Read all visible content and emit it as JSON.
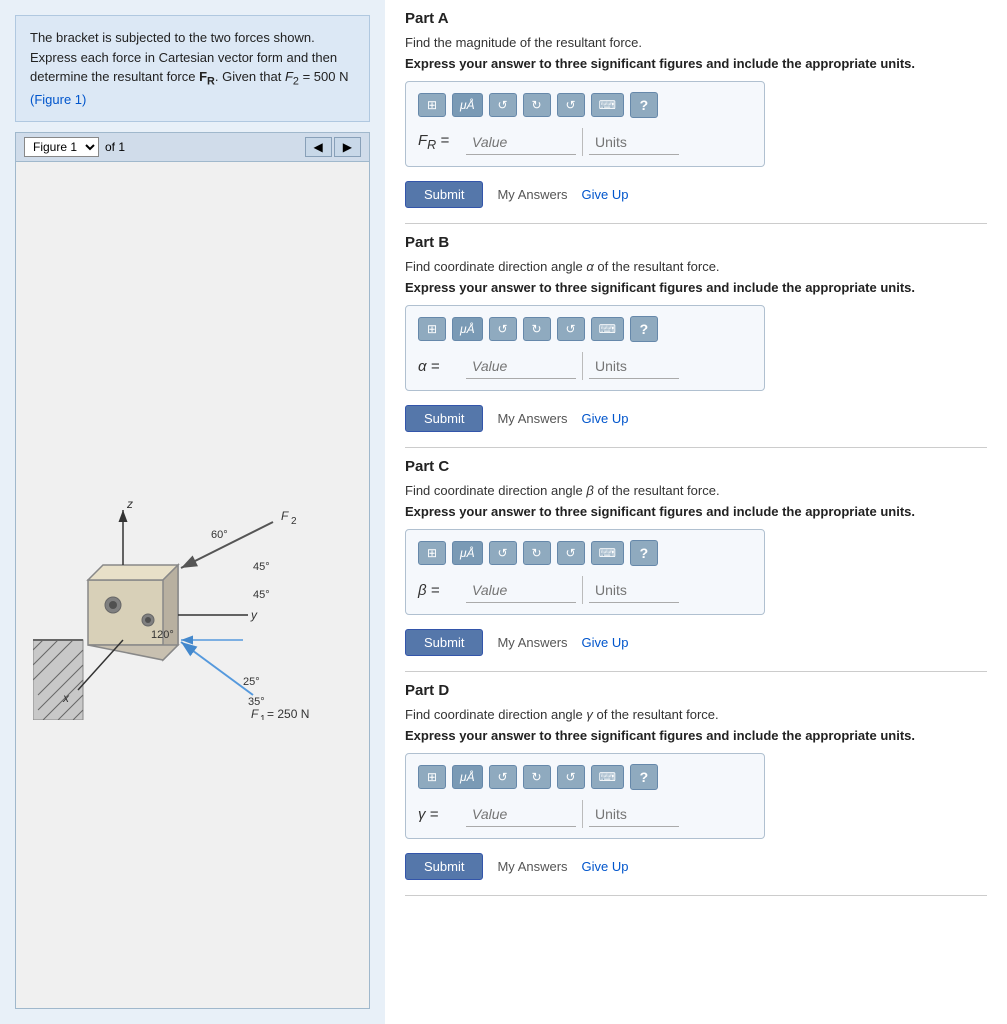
{
  "left": {
    "problem_text": "The bracket is subjected to the two forces shown. Express each force in Cartesian vector form and then determine the resultant force ",
    "bold_fr": "F",
    "sub_r": "R",
    "given": ". Given that ",
    "f2": "F",
    "sub_2": "2",
    "given_val": " = 500 N ",
    "figure_link": "(Figure 1)",
    "figure_label": "Figure 1",
    "of_label": "of 1"
  },
  "parts": [
    {
      "id": "A",
      "title": "Part A",
      "description": "Find the magnitude of the resultant force.",
      "instruction": "Express your answer to three significant figures and include the appropriate units.",
      "label": "F",
      "sub": "R",
      "eq": "=",
      "value_placeholder": "Value",
      "units_placeholder": "Units"
    },
    {
      "id": "B",
      "title": "Part B",
      "description": "Find coordinate direction angle α of the resultant force.",
      "instruction": "Express your answer to three significant figures and include the appropriate units.",
      "label": "α",
      "sub": "",
      "eq": "=",
      "value_placeholder": "Value",
      "units_placeholder": "Units"
    },
    {
      "id": "C",
      "title": "Part C",
      "description": "Find coordinate direction angle β of the resultant force.",
      "instruction": "Express your answer to three significant figures and include the appropriate units.",
      "label": "β",
      "sub": "",
      "eq": "=",
      "value_placeholder": "Value",
      "units_placeholder": "Units"
    },
    {
      "id": "D",
      "title": "Part D",
      "description": "Find coordinate direction angle γ of the resultant force.",
      "instruction": "Express your answer to three significant figures and include the appropriate units.",
      "label": "γ",
      "sub": "",
      "eq": "=",
      "value_placeholder": "Value",
      "units_placeholder": "Units"
    }
  ],
  "toolbar": {
    "grid_icon": "⊞",
    "mu_icon": "μÅ",
    "undo_icon": "↺",
    "redo_icon": "↻",
    "refresh_icon": "↺",
    "keyboard_icon": "⌨",
    "help_icon": "?"
  },
  "buttons": {
    "submit": "Submit",
    "my_answers": "My Answers",
    "give_up": "Give Up"
  }
}
